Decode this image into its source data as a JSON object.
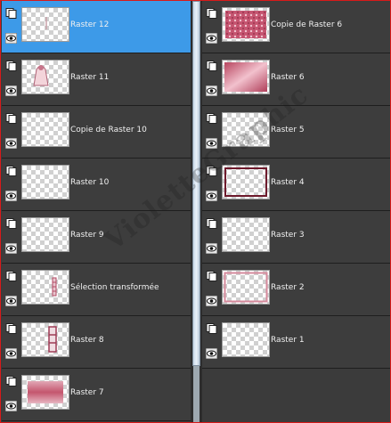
{
  "layers_left": [
    {
      "name": "Raster 12",
      "selected": true,
      "thumb": "faint-mark"
    },
    {
      "name": "Raster 11",
      "selected": false,
      "thumb": "figure"
    },
    {
      "name": "Copie de Raster 10",
      "selected": false,
      "thumb": "empty"
    },
    {
      "name": "Raster 10",
      "selected": false,
      "thumb": "empty"
    },
    {
      "name": "Raster 9",
      "selected": false,
      "thumb": "empty"
    },
    {
      "name": "Sélection transformée",
      "selected": false,
      "thumb": "small-column"
    },
    {
      "name": "Raster 8",
      "selected": false,
      "thumb": "column"
    },
    {
      "name": "Raster 7",
      "selected": false,
      "thumb": "pink-fill"
    }
  ],
  "layers_right": [
    {
      "name": "Copie de Raster 6",
      "selected": false,
      "thumb": "pink-texture"
    },
    {
      "name": "Raster 6",
      "selected": false,
      "thumb": "pink-gradient"
    },
    {
      "name": "Raster 5",
      "selected": false,
      "thumb": "empty"
    },
    {
      "name": "Raster 4",
      "selected": false,
      "thumb": "dark-frame"
    },
    {
      "name": "Raster 3",
      "selected": false,
      "thumb": "empty"
    },
    {
      "name": "Raster 2",
      "selected": false,
      "thumb": "pink-frame"
    },
    {
      "name": "Raster 1",
      "selected": false,
      "thumb": "empty"
    }
  ],
  "watermark": "VioletteGraphic",
  "colors": {
    "selected": "#3d9ae8",
    "panel": "#3d3d3d",
    "accent_pink": "#c4566e"
  }
}
